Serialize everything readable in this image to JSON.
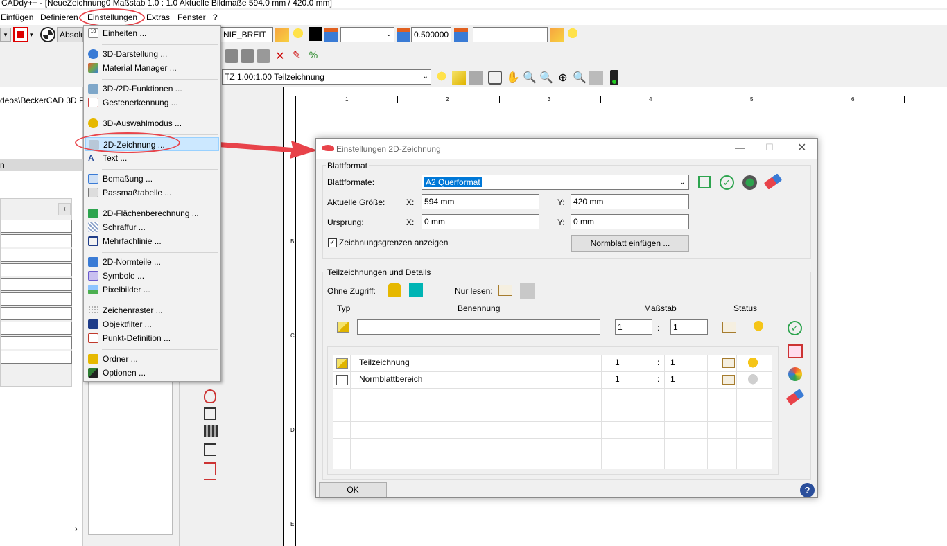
{
  "window": {
    "title": " CADdy++ - [NeueZeichnung0   Maßstab 1.0 : 1.0   Aktuelle Bildmaße 594.0 mm / 420.0 mm]"
  },
  "menubar": {
    "items": [
      "Einfügen",
      "Definieren",
      "Einstellungen",
      "Extras",
      "Fenster",
      "?"
    ]
  },
  "toolbar": {
    "mode_label": "Absolu",
    "linetype_value": "NIE_BREIT",
    "width_value": "0.500000",
    "blank_field": "",
    "view_select": "TZ 1.00:1.00 Teilzeichnung"
  },
  "left_panel": {
    "path_text": "deos\\BeckerCAD 3D Pr",
    "row_label": "n"
  },
  "menu": {
    "items": [
      {
        "label": "Einheiten ...",
        "icon": "units-icon",
        "color": "#555555"
      },
      {
        "label": "3D-Darstellung ...",
        "icon": "3d-display-icon",
        "color": "#3a7bd5"
      },
      {
        "label": "Material Manager ...",
        "icon": "material-icon",
        "color": "#6aa84f"
      },
      {
        "label": "3D-/2D-Funktionen ...",
        "icon": "3d-2d-functions-icon",
        "color": "#7fa7c9"
      },
      {
        "label": "Gestenerkennung ...",
        "icon": "gesture-icon",
        "color": "#c44"
      },
      {
        "label": "3D-Auswahlmodus ...",
        "icon": "3d-select-icon",
        "color": "#e6b800"
      },
      {
        "label": "2D-Zeichnung ...",
        "icon": "2d-drawing-icon",
        "color": "#9ab"
      },
      {
        "label": "Text ...",
        "icon": "text-icon",
        "color": "#2a4e9b"
      },
      {
        "label": "Bemaßung ...",
        "icon": "dimension-icon",
        "color": "#3a7bd5"
      },
      {
        "label": "Passmaßtabelle ...",
        "icon": "fit-table-icon",
        "color": "#777777"
      },
      {
        "label": "2D-Flächenberechnung ...",
        "icon": "area-calc-icon",
        "color": "#2da44e"
      },
      {
        "label": "Schraffur ...",
        "icon": "hatch-icon",
        "color": "#8aa1c9"
      },
      {
        "label": "Mehrfachlinie ...",
        "icon": "multiline-icon",
        "color": "#1f3c88"
      },
      {
        "label": "2D-Normteile ...",
        "icon": "standard-parts-icon",
        "color": "#3a7bd5"
      },
      {
        "label": "Symbole ...",
        "icon": "symbols-icon",
        "color": "#6a5acd"
      },
      {
        "label": "Pixelbilder ...",
        "icon": "pixel-image-icon",
        "color": "#4caf50"
      },
      {
        "label": "Zeichenraster ...",
        "icon": "grid-icon",
        "color": "#999999"
      },
      {
        "label": "Objektfilter ...",
        "icon": "object-filter-icon",
        "color": "#1f3c88"
      },
      {
        "label": "Punkt-Definition ...",
        "icon": "point-def-icon",
        "color": "#c0392b"
      },
      {
        "label": "Ordner ...",
        "icon": "folder-icon",
        "color": "#e6b800"
      },
      {
        "label": "Optionen ...",
        "icon": "options-icon",
        "color": "#2e7d32"
      }
    ]
  },
  "dialog": {
    "title": "Einstellungen 2D-Zeichnung",
    "sheet": {
      "group": "Blattformat",
      "formats_label": "Blattformate:",
      "formats_value": "A2 Querformat",
      "size_label": "Aktuelle Größe:",
      "x_label": "X:",
      "y_label": "Y:",
      "size_x": "594 mm",
      "size_y": "420 mm",
      "origin_label": "Ursprung:",
      "origin_x": "0 mm",
      "origin_y": "0 mm",
      "limits_checkbox": "Zeichnungsgrenzen anzeigen",
      "limits_checked": true,
      "normblatt_button": "Normblatt einfügen ..."
    },
    "parts": {
      "group": "Teilzeichnungen und Details",
      "no_access": "Ohne Zugriff:",
      "read_only": "Nur lesen:",
      "col_type": "Typ",
      "col_name": "Benennung",
      "col_scale": "Maßstab",
      "col_status": "Status",
      "new_name": "",
      "new_scale_a": "1",
      "new_scale_sep": ":",
      "new_scale_b": "1",
      "rows": [
        {
          "name": "Teilzeichnung",
          "scale_a": "1",
          "sep": ":",
          "scale_b": "1",
          "lamp": "#f5c518"
        },
        {
          "name": "Normblattbereich",
          "scale_a": "1",
          "sep": ":",
          "scale_b": "1",
          "lamp": "#cfcfcf"
        }
      ]
    },
    "ok_button": "OK"
  },
  "canvas": {
    "ruler_top": [
      "1",
      "2",
      "3",
      "4",
      "5",
      "6"
    ],
    "ruler_left": [
      "B",
      "C",
      "D",
      "E"
    ]
  },
  "colors": {
    "accent": "#e8434a",
    "selection": "#0078d7",
    "teal": "#00b4b4"
  }
}
